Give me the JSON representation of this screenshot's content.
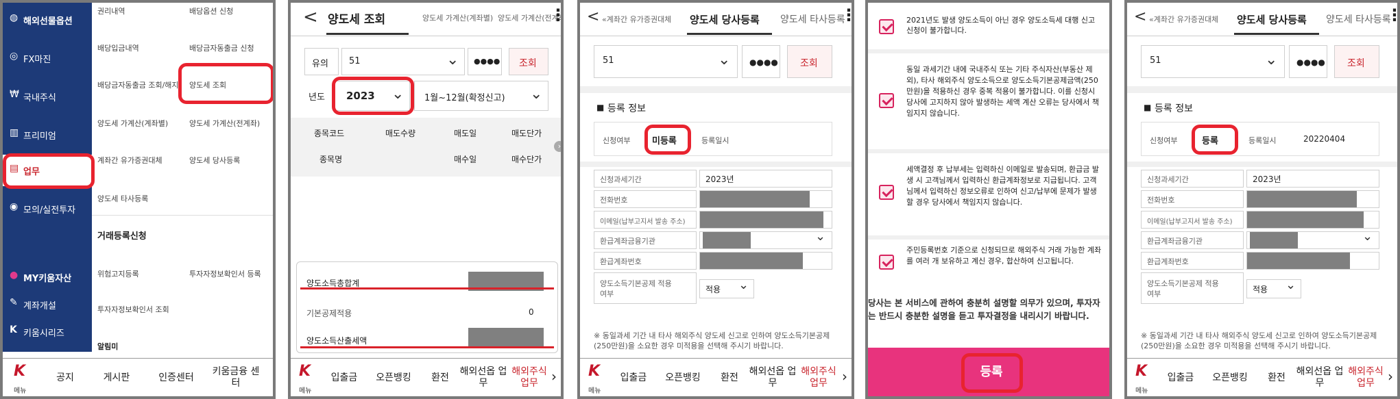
{
  "p1": {
    "nav": [
      "해외선물옵션",
      "FX마진",
      "국내주식",
      "프리미엄",
      "업무",
      "모의/실전투자",
      "MY키움자산",
      "계좌개설",
      "키움시리즈"
    ],
    "menu": [
      "권리내역",
      "배당옵션 신청",
      "배당입금내역",
      "배당금자동출금 신청",
      "배당금자동출금 조회/해지",
      "양도세 조회",
      "양도세 가계산(계좌별)",
      "양도세 가계산(전계좌)",
      "계좌간 유가증권대체",
      "양도세 당사등록",
      "양도세 타사등록"
    ],
    "section": "거래등록신청",
    "menu2": [
      "위험고지등록",
      "투자자정보확인서 등록",
      "투자자정보확인서 조회",
      "알림미"
    ],
    "bottom": [
      "메뉴",
      "공지",
      "게시판",
      "인증센터",
      "키움금융 센터"
    ]
  },
  "p2": {
    "back": "<",
    "tabs": [
      "양도세 조회",
      "양도세 가계산(계좌별)",
      "양도세 가계산(전계좌)"
    ],
    "more": "⋮",
    "acct_label": "유의",
    "acct_value": "51",
    "pw": "●●●●",
    "query": "조회",
    "year_label": "년도",
    "year_value": "2023",
    "period": "1월~12월(확정신고)",
    "table_head1": [
      "종목코드",
      "매도수량",
      "매도일",
      "매도단가"
    ],
    "table_head2": [
      "종목명",
      "",
      "매수일",
      "매수단가"
    ],
    "summary": [
      "양도소득총합계",
      "기본공제적용",
      "양도소득산출세액"
    ],
    "deduct_value": "0",
    "bottom": [
      "메뉴",
      "입출금",
      "오픈뱅킹",
      "환전",
      "해외선옵 업무",
      "해외주식 업무"
    ]
  },
  "p3": {
    "tabs": [
      "«계좌간 유가증권대체",
      "양도세 당사등록",
      "양도세 타사등록"
    ],
    "more": "⋮",
    "acct_value": "51",
    "pw": "●●●●",
    "query": "조회",
    "reg_title": "등록 정보",
    "apply_label": "신청여부",
    "apply_value": "미등록",
    "date_label": "등록일시",
    "fields": [
      "신청과세기간",
      "전화번호",
      "이메일(납부고지서 발송 주소)",
      "환급계좌금융기관",
      "환급계좌번호",
      "양도소득기본공제 적용여부"
    ],
    "tax_period": "2023년",
    "apply_opt": "적용",
    "note": "※ 동일과세 기간 내 타사 해외주식 양도세 신고로 인하여 양도소득기본공제(250만원)을 소요한 경우 미적용을 선택해 주시기 바랍니다.",
    "bottom": [
      "메뉴",
      "입출금",
      "오픈뱅킹",
      "환전",
      "해외선옵 업무",
      "해외주식 업무"
    ]
  },
  "p4": {
    "items": [
      "2021년도 발생 양도소득이 아닌 경우 양도소득세 대행 신고 신청이 불가합니다.",
      "동일 과세기간 내에 국내주식 또는 기타 주식자산(부동산 제외), 타사 해외주식 양도소득으로 양도소득기본공제금액(250만원)을 적용하신 경우 중복 적용이 불가합니다. 이를 신청시 당사에 고지하지 않아 발생하는 세액 계산 오류는 당사에서 책임지지 않습니다.",
      "세액결정 후 납부세는 입력하신 이메일로 발송되며, 환급금 발생 시 고객님께서 입력하신 환급계좌정보로 지급됩니다. 고객님께서 입력하신 정보오류로 인하여 신고/납부에 문제가 발생할 경우 당사에서 책임지지 않습니다.",
      "주민등록번호 기준으로 신청되므로 해외주식 거래 가능한 계좌를 여러 개 보유하고 계신 경우, 합산하여 신고됩니다."
    ],
    "footer": "당사는 본 서비스에 관하여 충분히 설명할 의무가 있으며, 투자자는 반드시 충분한 설명을 듣고 투자결정을 내리시기 바랍니다.",
    "register": "등록"
  },
  "p5": {
    "tabs": [
      "«계좌간 유가증권대체",
      "양도세 당사등록",
      "양도세 타사등록"
    ],
    "more": "⋮",
    "acct_value": "51",
    "pw": "●●●●",
    "query": "조회",
    "reg_title": "등록 정보",
    "apply_label": "신청여부",
    "apply_value": "등록",
    "date_label": "등록일시",
    "date_value": "20220404",
    "fields": [
      "신청과세기간",
      "전화번호",
      "이메일(납부고지서 발송 주소)",
      "환급계좌금융기관",
      "환급계좌번호",
      "양도소득기본공제 적용여부"
    ],
    "tax_period": "2023년",
    "apply_opt": "적용",
    "note": "※ 동일과세 기간 내 타사 해외주식 양도세 신고로 인하여 양도소득기본공제(250만원)을 소요한 경우 미적용을 선택해 주시기 바랍니다.",
    "bottom": [
      "메뉴",
      "입출금",
      "오픈뱅킹",
      "환전",
      "해외선옵 업무",
      "해외주식 업무"
    ]
  }
}
